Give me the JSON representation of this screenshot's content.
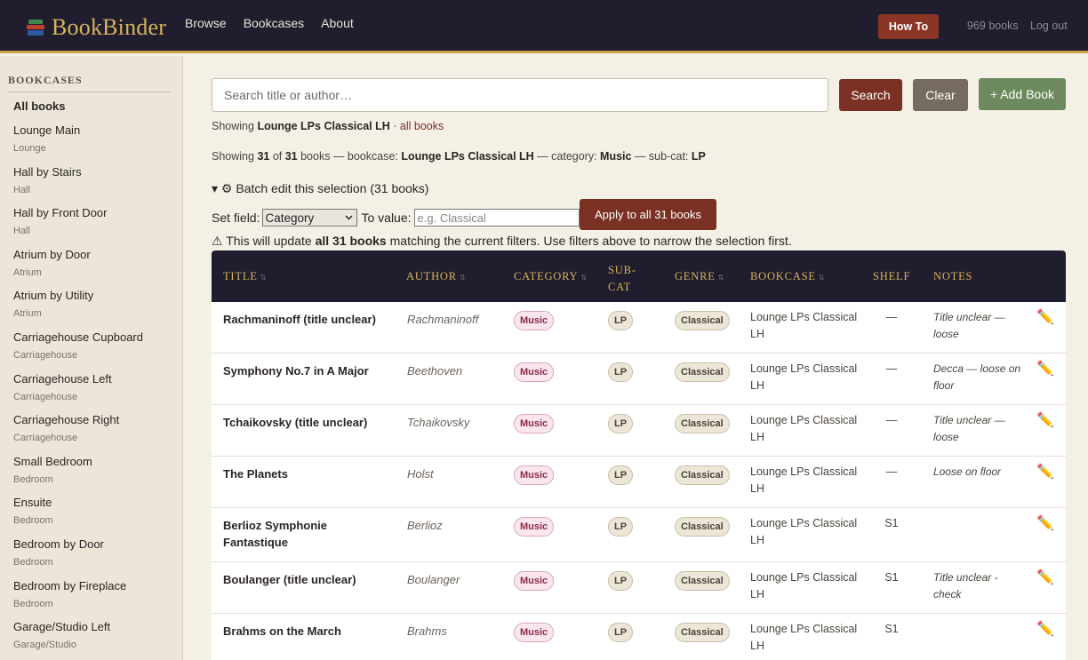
{
  "header": {
    "brand": "BookBinder",
    "nav": [
      "Browse",
      "Bookcases",
      "About"
    ],
    "how_to": "How To",
    "book_count": "969 books",
    "logout": "Log out",
    "colors": {
      "bar": "#1f1d2e",
      "accent": "#c9a24a",
      "brand": "#d9b45a"
    }
  },
  "sidebar": {
    "heading": "BOOKCASES",
    "all": "All books",
    "items": [
      {
        "name": "Lounge Main",
        "location": "Lounge"
      },
      {
        "name": "Hall by Stairs",
        "location": "Hall"
      },
      {
        "name": "Hall by Front Door",
        "location": "Hall"
      },
      {
        "name": "Atrium by Door",
        "location": "Atrium"
      },
      {
        "name": "Atrium by Utility",
        "location": "Atrium"
      },
      {
        "name": "Carriagehouse Cupboard",
        "location": "Carriagehouse"
      },
      {
        "name": "Carriagehouse Left",
        "location": "Carriagehouse"
      },
      {
        "name": "Carriagehouse Right",
        "location": "Carriagehouse"
      },
      {
        "name": "Small Bedroom",
        "location": "Bedroom"
      },
      {
        "name": "Ensuite",
        "location": "Bedroom"
      },
      {
        "name": "Bedroom by Door",
        "location": "Bedroom"
      },
      {
        "name": "Bedroom by Fireplace",
        "location": "Bedroom"
      },
      {
        "name": "Garage/Studio Left",
        "location": "Garage/Studio"
      }
    ]
  },
  "search": {
    "placeholder": "Search title or author…",
    "search_btn": "Search",
    "clear_btn": "Clear",
    "add_btn": "+ Add Book"
  },
  "status": {
    "showing_label": "Showing",
    "bookcase": "Lounge LPs Classical LH",
    "sep": " · ",
    "all_books_link": "all books",
    "shown": "31",
    "total": "31",
    "category": "Music",
    "subcat": "LP"
  },
  "batch": {
    "summary": "▾ ⚙ Batch edit this selection (31 books)",
    "set_field_label": "Set field:",
    "field_value": "Category",
    "to_value_label": "To value:",
    "value_placeholder": "e.g. Classical",
    "apply_btn": "Apply to all 31 books",
    "warning_prefix": "⚠ This will update ",
    "warning_bold": "all 31 books",
    "warning_suffix": " matching the current filters. Use filters above to narrow the selection first."
  },
  "table": {
    "columns": {
      "title": "TITLE",
      "author": "AUTHOR",
      "category": "CATEGORY",
      "subcat1": "SUB-",
      "subcat2": "CAT",
      "genre": "GENRE",
      "bookcase": "BOOKCASE",
      "shelf": "SHELF",
      "notes": "NOTES"
    },
    "rows": [
      {
        "title": "Rachmaninoff (title unclear)",
        "author": "Rachmaninoff",
        "category": "Music",
        "subcat": "LP",
        "genre": "Classical",
        "bookcase": "Lounge LPs Classical LH",
        "shelf": "—",
        "notes": "Title unclear — loose"
      },
      {
        "title": "Symphony No.7 in A Major",
        "author": "Beethoven",
        "category": "Music",
        "subcat": "LP",
        "genre": "Classical",
        "bookcase": "Lounge LPs Classical LH",
        "shelf": "—",
        "notes": "Decca — loose on floor"
      },
      {
        "title": "Tchaikovsky (title unclear)",
        "author": "Tchaikovsky",
        "category": "Music",
        "subcat": "LP",
        "genre": "Classical",
        "bookcase": "Lounge LPs Classical LH",
        "shelf": "—",
        "notes": "Title unclear — loose"
      },
      {
        "title": "The Planets",
        "author": "Holst",
        "category": "Music",
        "subcat": "LP",
        "genre": "Classical",
        "bookcase": "Lounge LPs Classical LH",
        "shelf": "—",
        "notes": "Loose on floor"
      },
      {
        "title": "Berlioz Symphonie Fantastique",
        "author": "Berlioz",
        "category": "Music",
        "subcat": "LP",
        "genre": "Classical",
        "bookcase": "Lounge LPs Classical LH",
        "shelf": "S1",
        "notes": ""
      },
      {
        "title": "Boulanger (title unclear)",
        "author": "Boulanger",
        "category": "Music",
        "subcat": "LP",
        "genre": "Classical",
        "bookcase": "Lounge LPs Classical LH",
        "shelf": "S1",
        "notes": "Title unclear - check"
      },
      {
        "title": "Brahms on the March",
        "author": "Brahms",
        "category": "Music",
        "subcat": "LP",
        "genre": "Classical",
        "bookcase": "Lounge LPs Classical LH",
        "shelf": "S1",
        "notes": ""
      }
    ],
    "edit_icon": "pencil-icon",
    "edit_glyph": "✏️"
  }
}
